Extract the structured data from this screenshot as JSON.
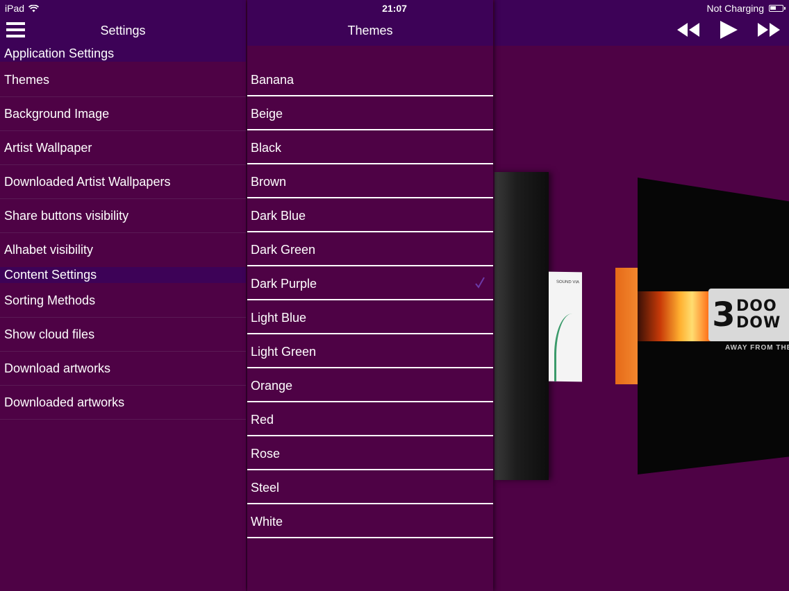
{
  "status_bar": {
    "device": "iPad",
    "wifi_icon": "wifi-icon",
    "time": "21:07",
    "charging": "Not Charging",
    "battery_icon": "battery-icon"
  },
  "player": {
    "controls": [
      "rewind-icon",
      "play-icon",
      "fast-forward-icon"
    ]
  },
  "settings_panel": {
    "title": "Settings",
    "menu_icon": "hamburger-menu-icon",
    "sections": [
      {
        "header": "Application Settings",
        "items": [
          "Themes",
          "Background Image",
          "Artist Wallpaper",
          "Downloaded Artist Wallpapers",
          "Share buttons visibility",
          "Alhabet visibility"
        ]
      },
      {
        "header": "Content Settings",
        "items": [
          "Sorting Methods",
          "Show cloud files",
          "Download artworks",
          "Downloaded artworks"
        ]
      }
    ]
  },
  "themes_panel": {
    "title": "Themes",
    "items": [
      "Banana",
      "Beige",
      "Black",
      "Brown",
      "Dark Blue",
      "Dark Green",
      "Dark Purple",
      "Light Blue",
      "Light Green",
      "Orange",
      "Red",
      "Rose",
      "Steel",
      "White"
    ],
    "selected": "Dark Purple"
  },
  "coverflow": {
    "white_cover_text": "SOUND VIA",
    "main_cover_number": "3",
    "main_cover_words": [
      "DOO",
      "DOW"
    ],
    "main_cover_subtitle": "AWAY FROM THE"
  },
  "colors": {
    "background": "#4e0245",
    "header": "#3d0257",
    "text": "#ffffff",
    "row_divider": "#5a1a55",
    "checkmark": "#6b3aa8"
  }
}
